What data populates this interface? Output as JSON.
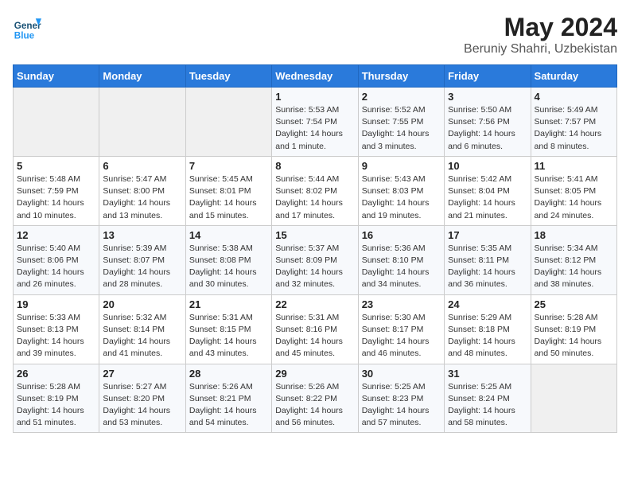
{
  "header": {
    "logo_text_general": "General",
    "logo_text_blue": "Blue",
    "title": "May 2024",
    "subtitle": "Beruniy Shahri, Uzbekistan"
  },
  "days_of_week": [
    "Sunday",
    "Monday",
    "Tuesday",
    "Wednesday",
    "Thursday",
    "Friday",
    "Saturday"
  ],
  "weeks": [
    [
      {
        "day": "",
        "info": ""
      },
      {
        "day": "",
        "info": ""
      },
      {
        "day": "",
        "info": ""
      },
      {
        "day": "1",
        "info": "Sunrise: 5:53 AM\nSunset: 7:54 PM\nDaylight: 14 hours\nand 1 minute."
      },
      {
        "day": "2",
        "info": "Sunrise: 5:52 AM\nSunset: 7:55 PM\nDaylight: 14 hours\nand 3 minutes."
      },
      {
        "day": "3",
        "info": "Sunrise: 5:50 AM\nSunset: 7:56 PM\nDaylight: 14 hours\nand 6 minutes."
      },
      {
        "day": "4",
        "info": "Sunrise: 5:49 AM\nSunset: 7:57 PM\nDaylight: 14 hours\nand 8 minutes."
      }
    ],
    [
      {
        "day": "5",
        "info": "Sunrise: 5:48 AM\nSunset: 7:59 PM\nDaylight: 14 hours\nand 10 minutes."
      },
      {
        "day": "6",
        "info": "Sunrise: 5:47 AM\nSunset: 8:00 PM\nDaylight: 14 hours\nand 13 minutes."
      },
      {
        "day": "7",
        "info": "Sunrise: 5:45 AM\nSunset: 8:01 PM\nDaylight: 14 hours\nand 15 minutes."
      },
      {
        "day": "8",
        "info": "Sunrise: 5:44 AM\nSunset: 8:02 PM\nDaylight: 14 hours\nand 17 minutes."
      },
      {
        "day": "9",
        "info": "Sunrise: 5:43 AM\nSunset: 8:03 PM\nDaylight: 14 hours\nand 19 minutes."
      },
      {
        "day": "10",
        "info": "Sunrise: 5:42 AM\nSunset: 8:04 PM\nDaylight: 14 hours\nand 21 minutes."
      },
      {
        "day": "11",
        "info": "Sunrise: 5:41 AM\nSunset: 8:05 PM\nDaylight: 14 hours\nand 24 minutes."
      }
    ],
    [
      {
        "day": "12",
        "info": "Sunrise: 5:40 AM\nSunset: 8:06 PM\nDaylight: 14 hours\nand 26 minutes."
      },
      {
        "day": "13",
        "info": "Sunrise: 5:39 AM\nSunset: 8:07 PM\nDaylight: 14 hours\nand 28 minutes."
      },
      {
        "day": "14",
        "info": "Sunrise: 5:38 AM\nSunset: 8:08 PM\nDaylight: 14 hours\nand 30 minutes."
      },
      {
        "day": "15",
        "info": "Sunrise: 5:37 AM\nSunset: 8:09 PM\nDaylight: 14 hours\nand 32 minutes."
      },
      {
        "day": "16",
        "info": "Sunrise: 5:36 AM\nSunset: 8:10 PM\nDaylight: 14 hours\nand 34 minutes."
      },
      {
        "day": "17",
        "info": "Sunrise: 5:35 AM\nSunset: 8:11 PM\nDaylight: 14 hours\nand 36 minutes."
      },
      {
        "day": "18",
        "info": "Sunrise: 5:34 AM\nSunset: 8:12 PM\nDaylight: 14 hours\nand 38 minutes."
      }
    ],
    [
      {
        "day": "19",
        "info": "Sunrise: 5:33 AM\nSunset: 8:13 PM\nDaylight: 14 hours\nand 39 minutes."
      },
      {
        "day": "20",
        "info": "Sunrise: 5:32 AM\nSunset: 8:14 PM\nDaylight: 14 hours\nand 41 minutes."
      },
      {
        "day": "21",
        "info": "Sunrise: 5:31 AM\nSunset: 8:15 PM\nDaylight: 14 hours\nand 43 minutes."
      },
      {
        "day": "22",
        "info": "Sunrise: 5:31 AM\nSunset: 8:16 PM\nDaylight: 14 hours\nand 45 minutes."
      },
      {
        "day": "23",
        "info": "Sunrise: 5:30 AM\nSunset: 8:17 PM\nDaylight: 14 hours\nand 46 minutes."
      },
      {
        "day": "24",
        "info": "Sunrise: 5:29 AM\nSunset: 8:18 PM\nDaylight: 14 hours\nand 48 minutes."
      },
      {
        "day": "25",
        "info": "Sunrise: 5:28 AM\nSunset: 8:19 PM\nDaylight: 14 hours\nand 50 minutes."
      }
    ],
    [
      {
        "day": "26",
        "info": "Sunrise: 5:28 AM\nSunset: 8:19 PM\nDaylight: 14 hours\nand 51 minutes."
      },
      {
        "day": "27",
        "info": "Sunrise: 5:27 AM\nSunset: 8:20 PM\nDaylight: 14 hours\nand 53 minutes."
      },
      {
        "day": "28",
        "info": "Sunrise: 5:26 AM\nSunset: 8:21 PM\nDaylight: 14 hours\nand 54 minutes."
      },
      {
        "day": "29",
        "info": "Sunrise: 5:26 AM\nSunset: 8:22 PM\nDaylight: 14 hours\nand 56 minutes."
      },
      {
        "day": "30",
        "info": "Sunrise: 5:25 AM\nSunset: 8:23 PM\nDaylight: 14 hours\nand 57 minutes."
      },
      {
        "day": "31",
        "info": "Sunrise: 5:25 AM\nSunset: 8:24 PM\nDaylight: 14 hours\nand 58 minutes."
      },
      {
        "day": "",
        "info": ""
      }
    ]
  ]
}
